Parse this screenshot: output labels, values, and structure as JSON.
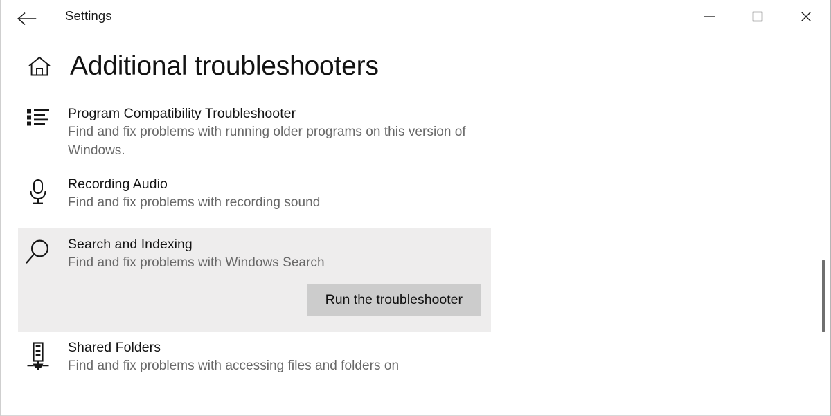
{
  "window": {
    "app_title": "Settings",
    "back_icon": "back-arrow-icon",
    "controls": {
      "minimize": "minimize-icon",
      "maximize": "maximize-icon",
      "close": "close-icon"
    }
  },
  "page": {
    "home_icon": "home-icon",
    "title": "Additional troubleshooters"
  },
  "troubleshooters": [
    {
      "icon": "bulleted-list-icon",
      "title": "Program Compatibility Troubleshooter",
      "description": "Find and fix problems with running older programs on this version of Windows.",
      "selected": false
    },
    {
      "icon": "microphone-icon",
      "title": "Recording Audio",
      "description": "Find and fix problems with recording sound",
      "selected": false
    },
    {
      "icon": "magnifier-icon",
      "title": "Search and Indexing",
      "description": "Find and fix problems with Windows Search",
      "selected": true,
      "action_label": "Run the troubleshooter"
    },
    {
      "icon": "shared-folders-icon",
      "title": "Shared Folders",
      "description": "Find and fix problems with accessing files and folders on",
      "selected": false
    }
  ],
  "colors": {
    "page_background": "#ffffff",
    "selected_row": "#eeeded",
    "button_fill": "#cccccc",
    "title_text": "#121212",
    "description_text": "#686868",
    "scrollbar_thumb": "#6f6f6f"
  },
  "scrollbar": {
    "name": "vertical-scrollbar"
  }
}
